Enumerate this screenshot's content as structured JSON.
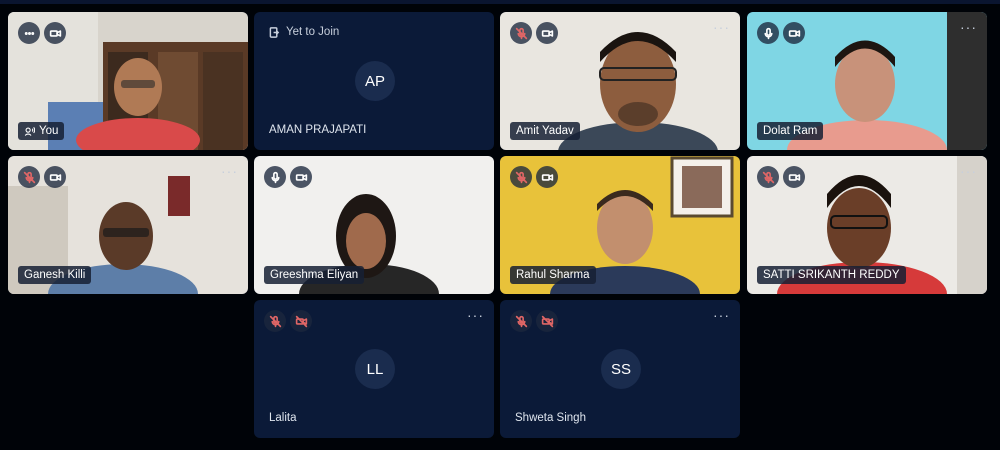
{
  "participants": [
    {
      "name": "You",
      "state": "video",
      "mic": "speaking",
      "camera": "on"
    },
    {
      "name": "AMAN PRAJAPATI",
      "initials": "AP",
      "state": "yet-to-join",
      "status_text": "Yet to Join"
    },
    {
      "name": "Amit Yadav",
      "state": "video",
      "mic": "muted",
      "camera": "on"
    },
    {
      "name": "Dolat Ram",
      "state": "video",
      "mic": "on",
      "camera": "on"
    },
    {
      "name": "Ganesh Killi",
      "state": "video",
      "mic": "muted",
      "camera": "on"
    },
    {
      "name": "Greeshma Eliyan",
      "state": "video",
      "mic": "on",
      "camera": "on"
    },
    {
      "name": "Rahul Sharma",
      "state": "video",
      "mic": "muted",
      "camera": "on"
    },
    {
      "name": "SATTI SRIKANTH REDDY",
      "state": "video",
      "mic": "muted",
      "camera": "on"
    },
    {
      "name": "Lalita",
      "initials": "LL",
      "state": "no-video",
      "mic": "muted",
      "camera": "off"
    },
    {
      "name": "Shweta Singh",
      "initials": "SS",
      "state": "no-video",
      "mic": "muted",
      "camera": "off"
    }
  ],
  "icons": {
    "more": "more-options-icon",
    "mic": "microphone-icon",
    "mic_muted": "microphone-muted-icon",
    "camera": "camera-icon",
    "camera_off": "camera-off-icon",
    "speaking": "speaking-icon",
    "join": "door-enter-icon"
  },
  "colors": {
    "background": "#000308",
    "tile": "#0c1d3a",
    "muted": "#e06666"
  }
}
